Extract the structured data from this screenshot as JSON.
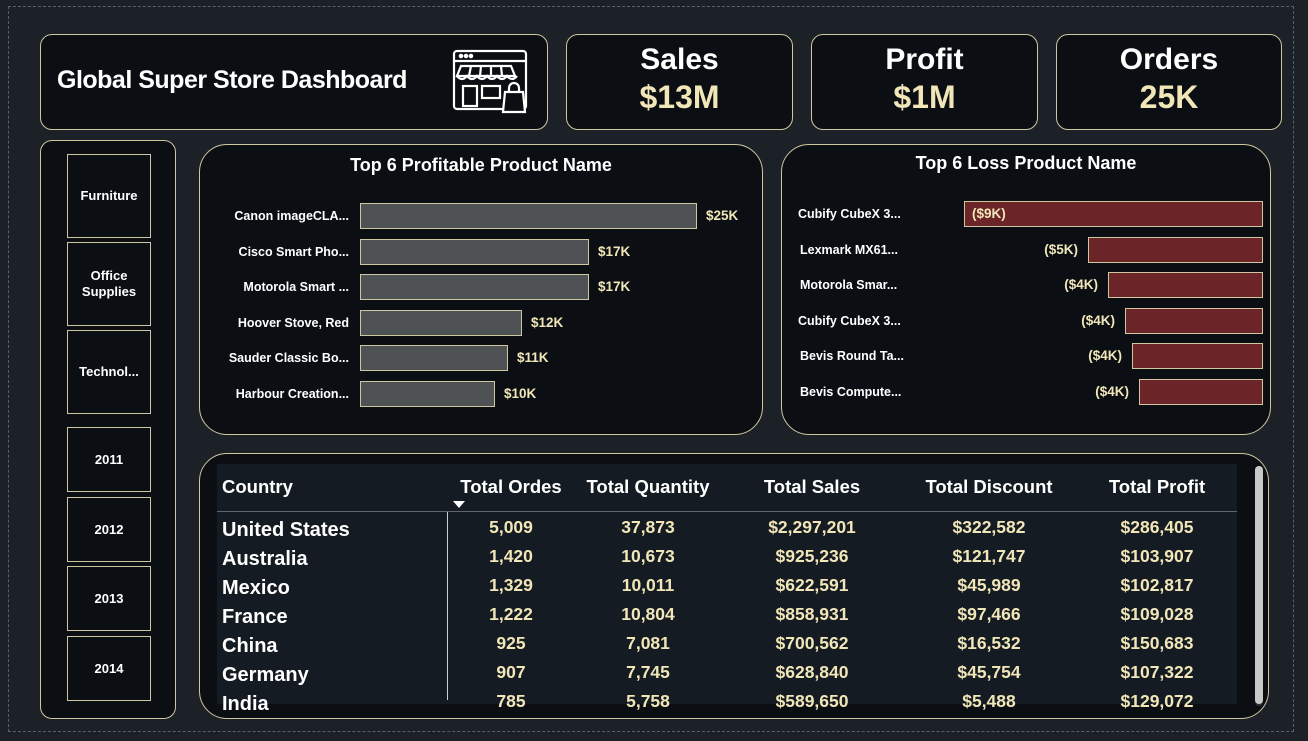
{
  "title": "Global Super Store Dashboard",
  "kpis": [
    {
      "label": "Sales",
      "value": "$13M"
    },
    {
      "label": "Profit",
      "value": "$1M"
    },
    {
      "label": "Orders",
      "value": "25K"
    }
  ],
  "slicers": {
    "categories": [
      "Furniture",
      "Office Supplies",
      "Technol..."
    ],
    "years": [
      "2011",
      "2012",
      "2013",
      "2014"
    ]
  },
  "colors": {
    "accent": "#f1e6b8",
    "border": "#cfc7a0",
    "profit_bar": "#4f5255",
    "loss_bar": "#6b2427",
    "background": "#1b2127",
    "card": "#0b0f13"
  },
  "icons": {
    "store": "storefront-icon"
  },
  "profit_chart": {
    "title": "Top 6 Profitable Product Name",
    "chart_data": {
      "type": "bar",
      "orientation": "horizontal",
      "categories": [
        "Canon imageCLA...",
        "Cisco Smart Pho...",
        "Motorola Smart ...",
        "Hoover Stove, Red",
        "Sauder Classic Bo...",
        "Harbour Creation..."
      ],
      "values": [
        25000,
        17000,
        17000,
        12000,
        11000,
        10000
      ],
      "labels": [
        "$25K",
        "$17K",
        "$17K",
        "$12K",
        "$11K",
        "$10K"
      ],
      "xlim": [
        0,
        25000
      ]
    }
  },
  "loss_chart": {
    "title": "Top 6 Loss Product Name",
    "chart_data": {
      "type": "bar",
      "orientation": "horizontal",
      "categories": [
        "Cubify CubeX 3...",
        "Lexmark MX61...",
        "Motorola Smar...",
        "Cubify CubeX 3...",
        "Bevis Round Ta...",
        "Bevis Compute..."
      ],
      "values": [
        -8900,
        -5200,
        -4600,
        -4100,
        -3900,
        -3700
      ],
      "labels": [
        "($9K)",
        "($5K)",
        "($4K)",
        "($4K)",
        "($4K)",
        "($4K)"
      ],
      "xlim": [
        -8900,
        0
      ]
    }
  },
  "table": {
    "columns": [
      "Country",
      "Total Ordes",
      "Total Quantity",
      "Total Sales",
      "Total Discount",
      "Total Profit"
    ],
    "rows": [
      [
        "United States",
        "5,009",
        "37,873",
        "$2,297,201",
        "$322,582",
        "$286,405"
      ],
      [
        "Australia",
        "1,420",
        "10,673",
        "$925,236",
        "$121,747",
        "$103,907"
      ],
      [
        "Mexico",
        "1,329",
        "10,011",
        "$622,591",
        "$45,989",
        "$102,817"
      ],
      [
        "France",
        "1,222",
        "10,804",
        "$858,931",
        "$97,466",
        "$109,028"
      ],
      [
        "China",
        "925",
        "7,081",
        "$700,562",
        "$16,532",
        "$150,683"
      ],
      [
        "Germany",
        "907",
        "7,745",
        "$628,840",
        "$45,754",
        "$107,322"
      ],
      [
        "India",
        "785",
        "5,758",
        "$589,650",
        "$5,488",
        "$129,072"
      ]
    ]
  }
}
